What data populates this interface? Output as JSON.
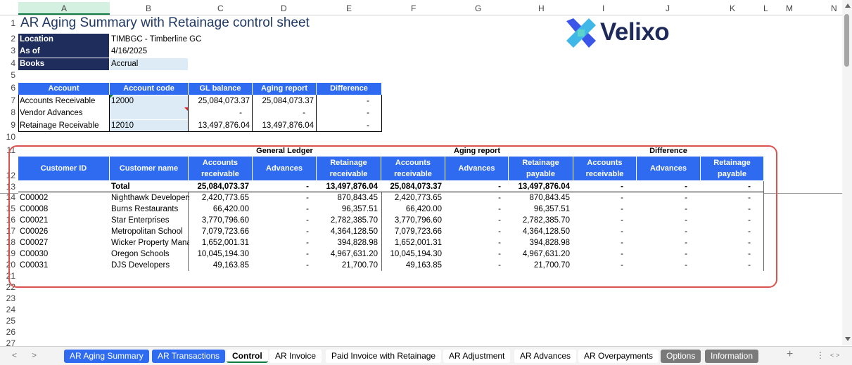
{
  "columns": [
    "A",
    "B",
    "C",
    "D",
    "E",
    "F",
    "G",
    "H",
    "I",
    "J",
    "K",
    "L",
    "M",
    "N"
  ],
  "rows": [
    "1",
    "2",
    "3",
    "4",
    "5",
    "6",
    "7",
    "8",
    "9",
    "10",
    "11",
    "12",
    "13",
    "14",
    "15",
    "16",
    "17",
    "18",
    "19",
    "20",
    "21",
    "22",
    "23",
    "24",
    "25",
    "26",
    "27"
  ],
  "title": "AR Aging Summary with Retainage control sheet",
  "brand": "Velixo",
  "info": [
    {
      "label": "Location",
      "value": "TIMBGC - Timberline GC"
    },
    {
      "label": "As of",
      "value": "4/16/2025"
    },
    {
      "label": "Books",
      "value": "Accrual"
    }
  ],
  "control": {
    "headers": [
      "Account",
      "Account code",
      "GL balance",
      "Aging report",
      "Difference"
    ],
    "rows": [
      {
        "account": "Accounts Receivable",
        "code": "12000",
        "gl": "25,084,073.37",
        "aging": "25,084,073.37",
        "diff": "-"
      },
      {
        "account": "Vendor Advances",
        "code": "",
        "gl": "-",
        "aging": "-",
        "diff": "-"
      },
      {
        "account": "Retainage Receivable",
        "code": "12010",
        "gl": "13,497,876.04",
        "aging": "13,497,876.04",
        "diff": "-"
      }
    ]
  },
  "groups": {
    "gl": "General Ledger",
    "aging": "Aging report",
    "diff": "Difference"
  },
  "detail": {
    "headers": [
      "Customer ID",
      "Customer name",
      "Accounts\nreceivable",
      "Advances",
      "Retainage\nreceivable",
      "Accounts\nreceivable",
      "Advances",
      "Retainage\npayable",
      "Accounts\nreceivable",
      "Advances",
      "Retainage\npayable"
    ],
    "total": [
      "",
      "Total",
      "25,084,073.37",
      "-",
      "13,497,876.04",
      "25,084,073.37",
      "-",
      "13,497,876.04",
      "-",
      "-",
      "-"
    ],
    "rows": [
      [
        "C00002",
        "Nighthawk Developers",
        "2,420,773.65",
        "-",
        "870,843.45",
        "2,420,773.65",
        "-",
        "870,843.45",
        "-",
        "-",
        "-"
      ],
      [
        "C00008",
        "Burns Restaurants",
        "66,420.00",
        "-",
        "96,357.51",
        "66,420.00",
        "-",
        "96,357.51",
        "-",
        "-",
        "-"
      ],
      [
        "C00021",
        "Star Enterprises",
        "3,770,796.60",
        "-",
        "2,782,385.70",
        "3,770,796.60",
        "-",
        "2,782,385.70",
        "-",
        "-",
        "-"
      ],
      [
        "C00026",
        "Metropolitan School",
        "7,079,723.66",
        "-",
        "4,364,128.50",
        "7,079,723.66",
        "-",
        "4,364,128.50",
        "-",
        "-",
        "-"
      ],
      [
        "C00027",
        "Wicker Property Management",
        "1,652,001.31",
        "-",
        "394,828.98",
        "1,652,001.31",
        "-",
        "394,828.98",
        "-",
        "-",
        "-"
      ],
      [
        "C00030",
        "Oregon Schools",
        "10,045,194.30",
        "-",
        "4,967,631.20",
        "10,045,194.30",
        "-",
        "4,967,631.20",
        "-",
        "-",
        "-"
      ],
      [
        "C00031",
        "DJS Developers",
        "49,163.85",
        "-",
        "21,700.70",
        "49,163.85",
        "-",
        "21,700.70",
        "-",
        "-",
        "-"
      ]
    ]
  },
  "tabs": [
    {
      "label": "AR Aging Summary",
      "style": "blue"
    },
    {
      "label": "AR Transactions",
      "style": "blue"
    },
    {
      "label": "Control",
      "style": "active"
    },
    {
      "label": "AR Invoice",
      "style": "white"
    },
    {
      "label": "Paid Invoice with Retainage",
      "style": "white"
    },
    {
      "label": "AR Adjustment",
      "style": "white"
    },
    {
      "label": "AR Advances",
      "style": "white"
    },
    {
      "label": "AR Overpayments",
      "style": "white"
    },
    {
      "label": "Options",
      "style": "grey"
    },
    {
      "label": "Information",
      "style": "grey"
    }
  ],
  "tabbar_controls": {
    "add": "+",
    "more": "⋮",
    "prev": "<",
    "next": ">"
  },
  "colors": {
    "navy": "#1f2d5c",
    "blue": "#2f6bf0",
    "accent_green": "#107c41",
    "highlight_red": "#d9534f",
    "title": "#1f3864"
  }
}
